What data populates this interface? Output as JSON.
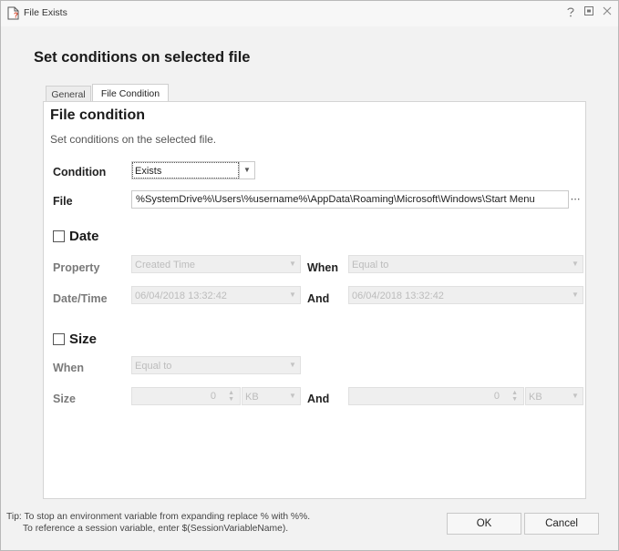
{
  "window": {
    "title": "File Exists",
    "icon": "file-warning-icon",
    "controls": [
      "help-icon",
      "restore-icon",
      "close-icon"
    ]
  },
  "heading": "Set conditions on selected file",
  "tabs": [
    {
      "label": "General",
      "active": false
    },
    {
      "label": "File Condition",
      "active": true
    }
  ],
  "panel": {
    "title": "File condition",
    "subtitle": "Set conditions on the selected file.",
    "condition": {
      "label": "Condition",
      "value": "Exists"
    },
    "file": {
      "label": "File",
      "value": "%SystemDrive%\\Users\\%username%\\AppData\\Roaming\\Microsoft\\Windows\\Start Menu",
      "browse_label": "⋯"
    },
    "date": {
      "checkbox_label": "Date",
      "checked": false,
      "property_label": "Property",
      "property_value": "Created Time",
      "when_label": "When",
      "when_value": "Equal to",
      "datetime_label": "Date/Time",
      "datetime_value": "06/04/2018 13:32:42",
      "and_label": "And",
      "and_value": "06/04/2018 13:32:42"
    },
    "size": {
      "checkbox_label": "Size",
      "checked": false,
      "when_label": "When",
      "when_value": "Equal to",
      "size_label": "Size",
      "size_value": "0",
      "size_unit": "KB",
      "and_label": "And",
      "and_value": "0",
      "and_unit": "KB"
    }
  },
  "tip": {
    "line1": "Tip: To stop an environment variable from expanding replace % with %%.",
    "line2": "To reference a session variable, enter $(SessionVariableName)."
  },
  "buttons": {
    "ok": "OK",
    "cancel": "Cancel"
  }
}
